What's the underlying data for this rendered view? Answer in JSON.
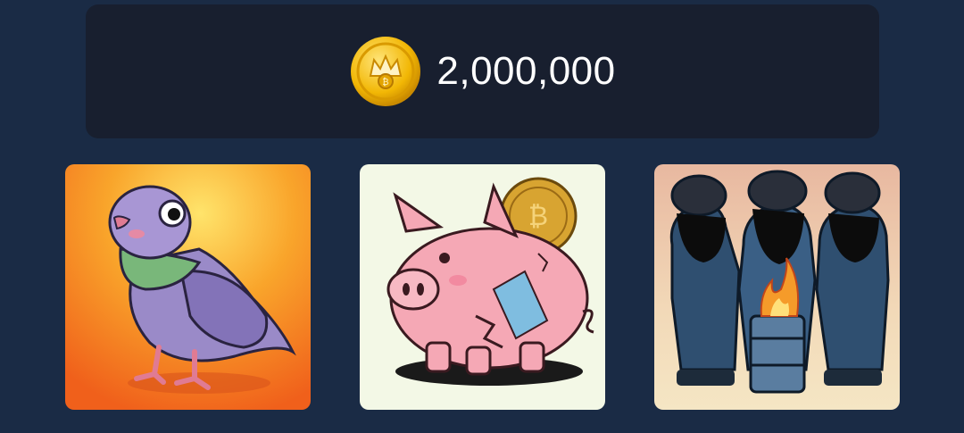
{
  "balance": {
    "amount": "2,000,000",
    "coin_icon": "crown-coin-icon",
    "coin_color": "#f2b705"
  },
  "cards": [
    {
      "icon": "pigeon-icon",
      "background": "#f28a1d"
    },
    {
      "icon": "broken-piggy-bank-icon",
      "background": "#f3f8e6"
    },
    {
      "icon": "hooded-figures-fire-barrel-icon",
      "background": "#e9c9a8"
    }
  ]
}
